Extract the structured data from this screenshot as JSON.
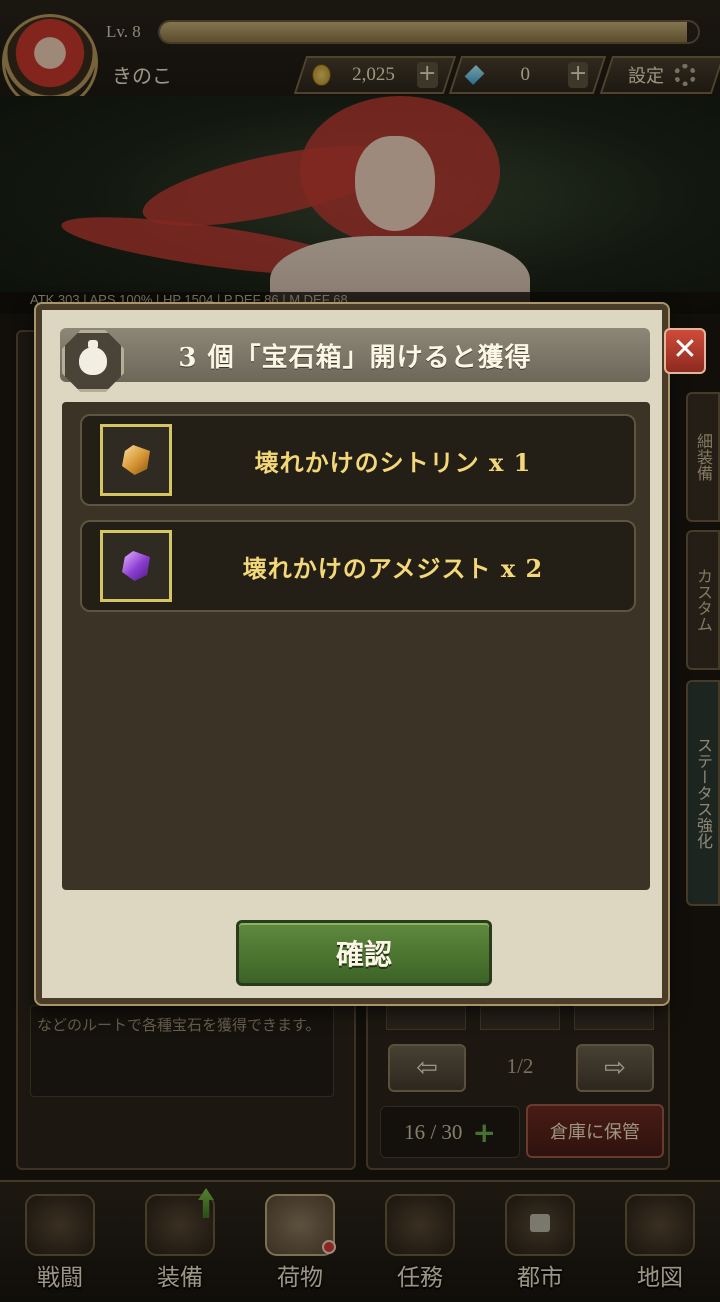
{
  "player": {
    "level": "Lv. 8",
    "name": "きのこ",
    "xp_fraction": 0.98
  },
  "currency": {
    "gold": "2,025",
    "gems": "0",
    "settings_label": "設定"
  },
  "hero_stats": "ATK 303   |   APS 100%   |   HP 1504   |   P.DEF 86   |   M.DEF 68",
  "background": {
    "description": "などのルートで各種宝石を獲得できます。",
    "page_indicator": "1/2",
    "capacity": "16 / 30",
    "store_button": "倉庫に保管",
    "side_tabs": [
      "細装備",
      "カスタム",
      "ステータス強化"
    ]
  },
  "modal": {
    "title": "3 個「宝石箱」開けると獲得",
    "rewards": [
      {
        "label": "壊れかけのシトリン x 1",
        "icon": "citrine-gem-icon"
      },
      {
        "label": "壊れかけのアメジスト x 2",
        "icon": "amethyst-gem-icon"
      }
    ],
    "confirm_label": "確認",
    "close_label": "✕"
  },
  "nav": {
    "items": [
      {
        "label": "戦闘",
        "icon": "battle-icon"
      },
      {
        "label": "装備",
        "icon": "equipment-icon"
      },
      {
        "label": "荷物",
        "icon": "bag-icon"
      },
      {
        "label": "任務",
        "icon": "quest-scroll-icon"
      },
      {
        "label": "都市",
        "icon": "city-icon"
      },
      {
        "label": "地図",
        "icon": "map-icon"
      }
    ]
  },
  "colors": {
    "modal_bg": "#ddd6c0",
    "reward_text": "#f4d878",
    "confirm_green": "#4f7a33",
    "close_red": "#b33b2c"
  }
}
